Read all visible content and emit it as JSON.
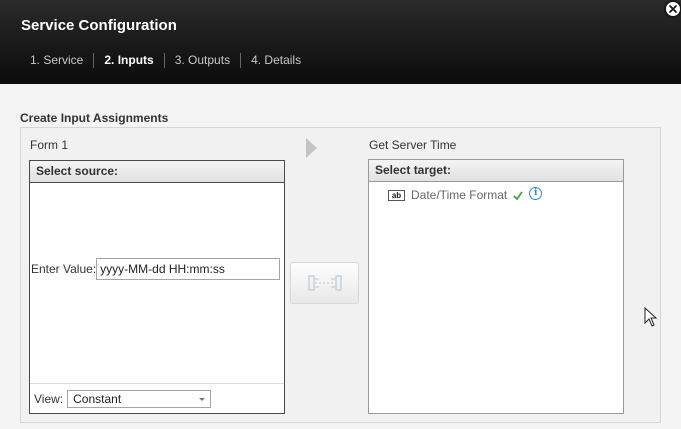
{
  "dialog": {
    "title": "Service Configuration",
    "close_icon": "close-icon"
  },
  "steps": [
    {
      "label": "1. Service",
      "active": false
    },
    {
      "label": "2. Inputs",
      "active": true
    },
    {
      "label": "3. Outputs",
      "active": false
    },
    {
      "label": "4. Details",
      "active": false
    }
  ],
  "content": {
    "heading": "Create Input Assignments",
    "source": {
      "title": "Form 1",
      "header": "Select source:",
      "enter_label": "Enter Value:",
      "enter_value": "yyyy-MM-dd HH:mm:ss",
      "view_label": "View:",
      "view_value": "Constant"
    },
    "target": {
      "title": "Get Server Time",
      "header": "Select target:",
      "item_type": "ab",
      "item_label": "Date/Time Format"
    }
  },
  "icons": {
    "arrow": "arrow-right-icon",
    "map": "map-connector-icon",
    "check": "check-icon",
    "info": "info-icon",
    "cursor": "mouse-cursor-icon"
  },
  "colors": {
    "header_bg": "#141414",
    "check": "#3aa53a",
    "info": "#2a8fc9"
  }
}
